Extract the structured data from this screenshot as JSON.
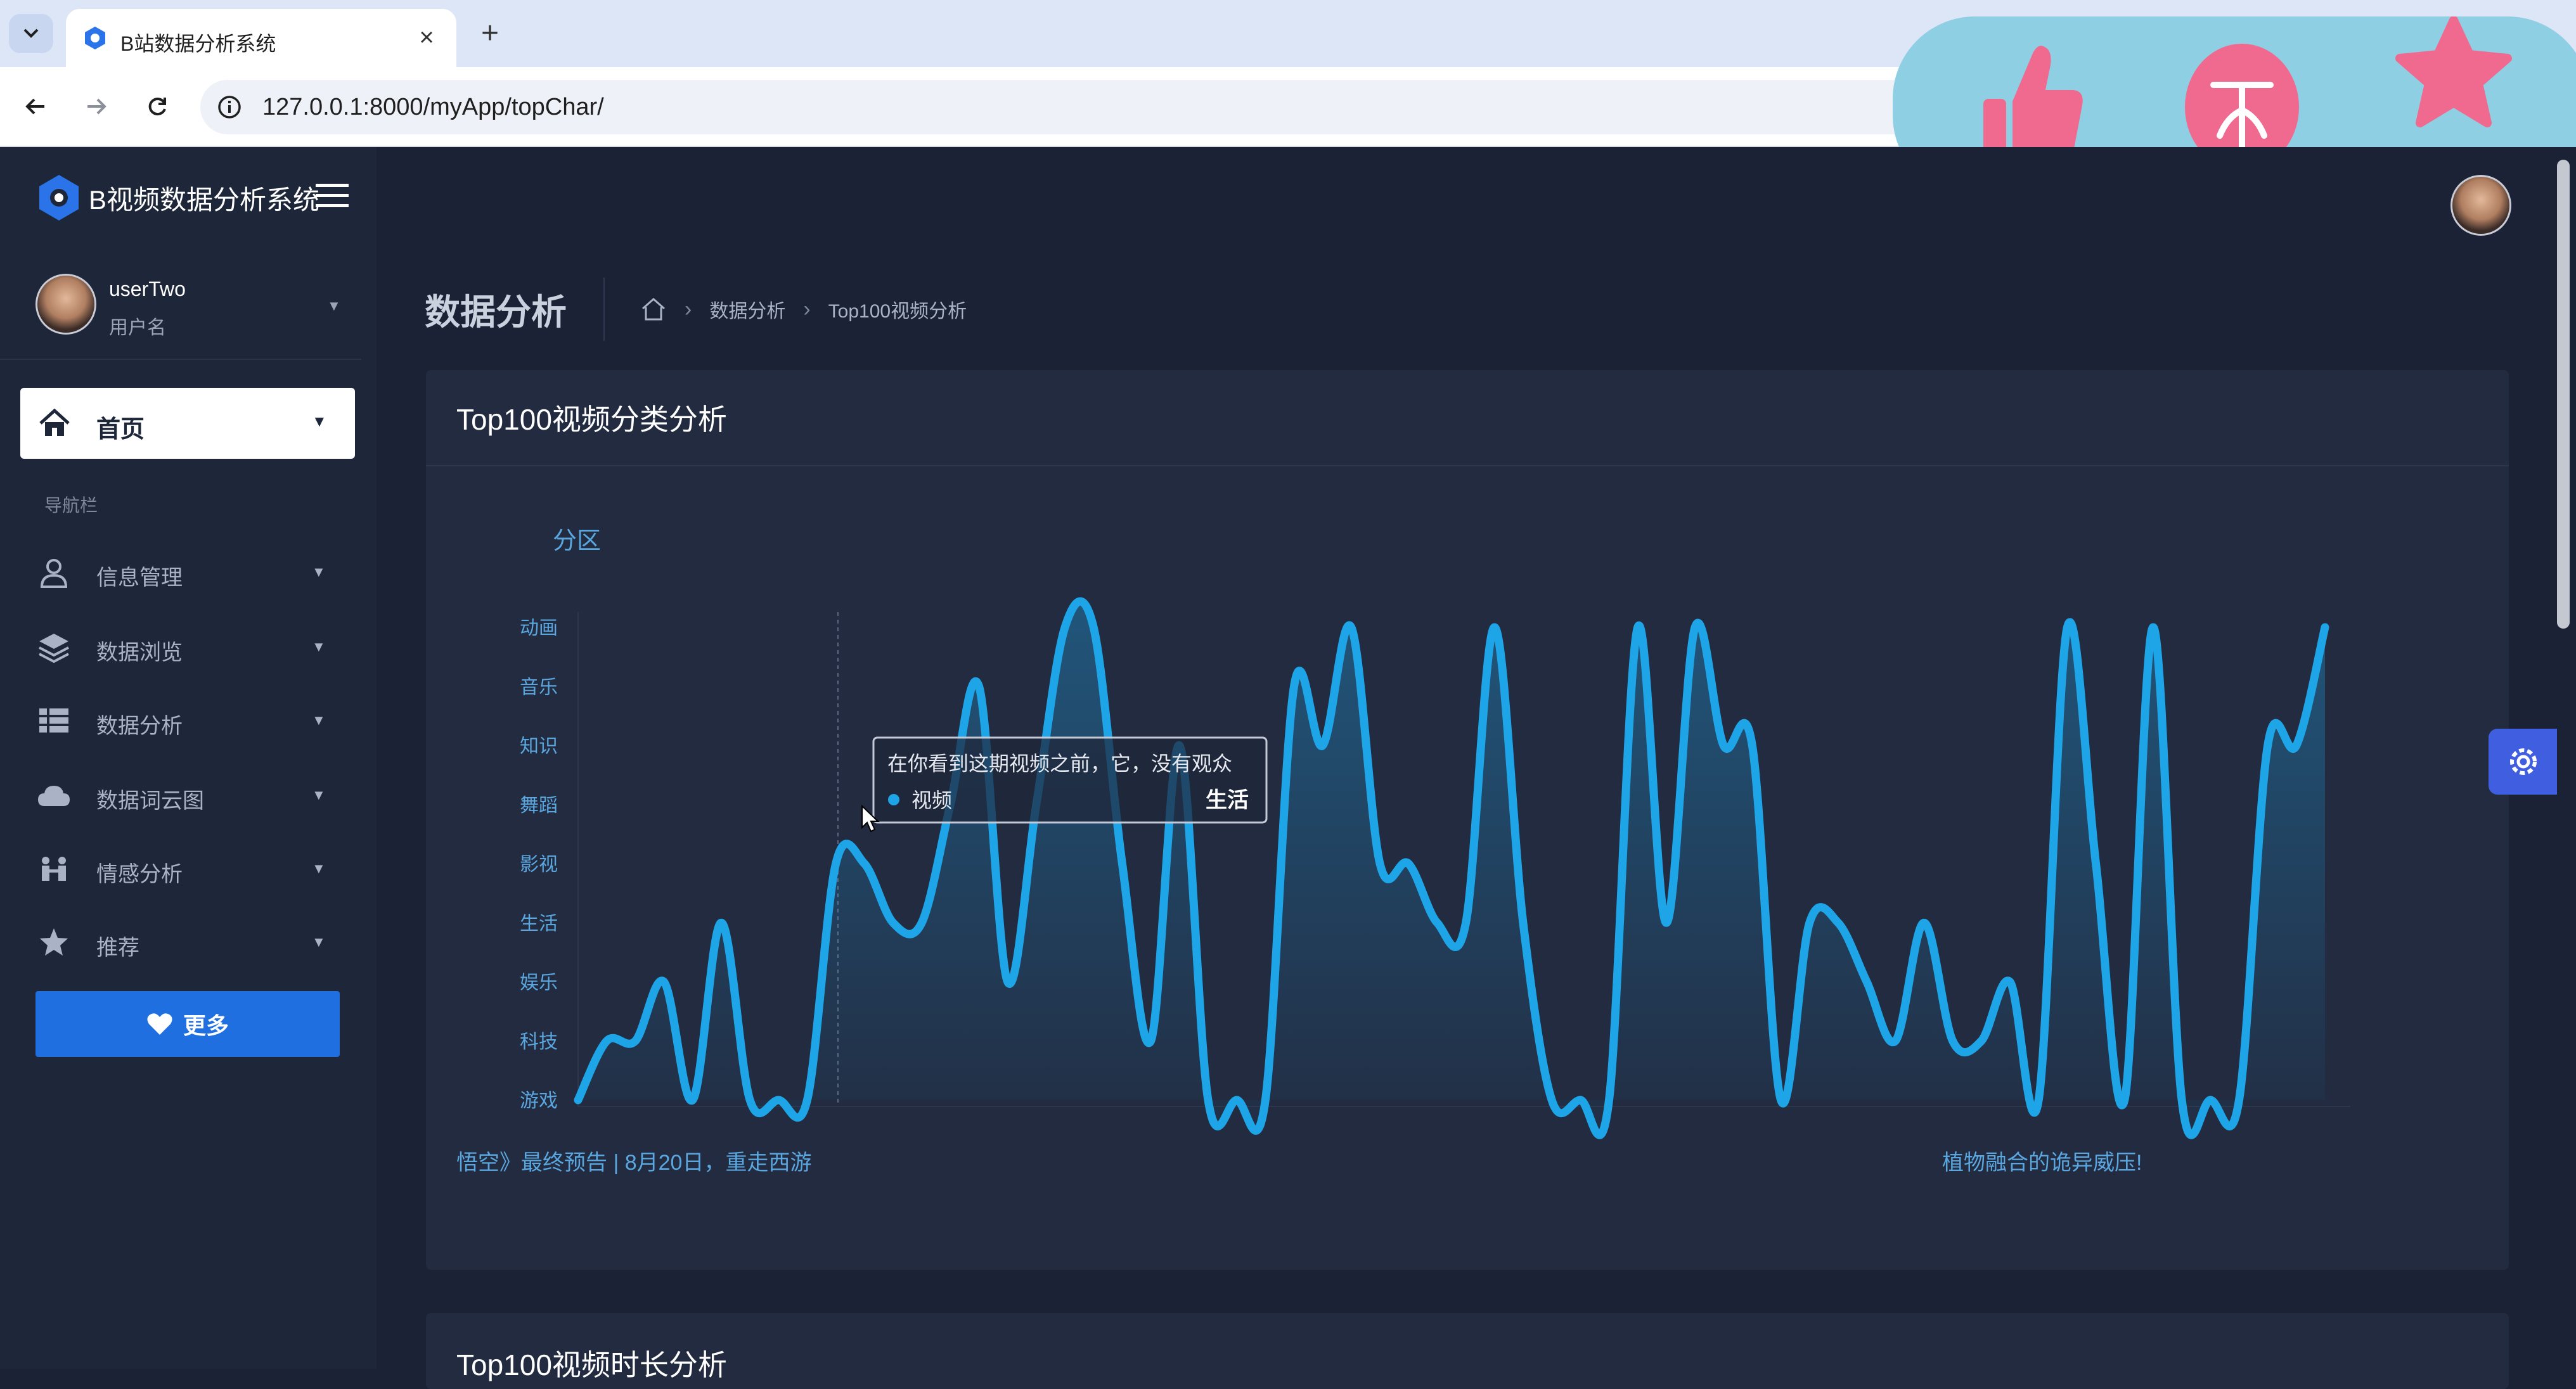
{
  "browser": {
    "tab_title": "B站数据分析系统",
    "url": "127.0.0.1:8000/myApp/topChar/"
  },
  "overlay": {
    "icons": [
      "thumbs-up-icon",
      "coin-icon",
      "star-icon"
    ],
    "color": "#f06a8f"
  },
  "app": {
    "brand": "B视频数据分析系统",
    "user": {
      "name": "userTwo",
      "role": "用户名"
    },
    "home_label": "首页",
    "nav_caption": "导航栏",
    "nav_items": [
      {
        "label": "信息管理",
        "icon": "user-icon"
      },
      {
        "label": "数据浏览",
        "icon": "layers-icon"
      },
      {
        "label": "数据分析",
        "icon": "table-icon"
      },
      {
        "label": "数据词云图",
        "icon": "cloud-icon"
      },
      {
        "label": "情感分析",
        "icon": "people-icon"
      },
      {
        "label": "推荐",
        "icon": "star-icon"
      }
    ],
    "more_label": "更多"
  },
  "page": {
    "title": "数据分析",
    "breadcrumb": [
      "数据分析",
      "Top100视频分析"
    ]
  },
  "card1": {
    "title": "Top100视频分类分析"
  },
  "card2": {
    "title": "Top100视频时长分析"
  },
  "chart_data": {
    "type": "area",
    "title": "",
    "ylabel": "分区",
    "categories": [
      "游戏",
      "科技",
      "娱乐",
      "生活",
      "影视",
      "舞蹈",
      "知识",
      "音乐",
      "动画"
    ],
    "series": [
      {
        "name": "视频",
        "values": [
          0,
          1,
          1,
          2,
          0,
          3,
          0,
          0,
          0,
          4,
          4,
          3,
          3,
          5,
          7,
          2,
          5,
          8,
          8,
          4,
          1,
          6,
          0,
          0,
          0,
          7,
          6,
          8,
          4,
          4,
          3,
          3,
          8,
          3,
          0,
          0,
          0,
          8,
          3,
          8,
          6,
          6,
          0,
          3,
          3,
          2,
          1,
          3,
          1,
          1,
          2,
          0,
          8,
          4,
          0,
          8,
          0,
          0,
          0,
          6,
          6,
          8
        ]
      }
    ],
    "color": "#1ea5e8",
    "tooltip": {
      "title": "在你看到这期视频之前，它，没有观众",
      "series": "视频",
      "value": "生活"
    },
    "x_labels_visible": [
      "悟空》最终预告 | 8月20日，重走西游",
      "植物融合的诡异威压!"
    ]
  }
}
